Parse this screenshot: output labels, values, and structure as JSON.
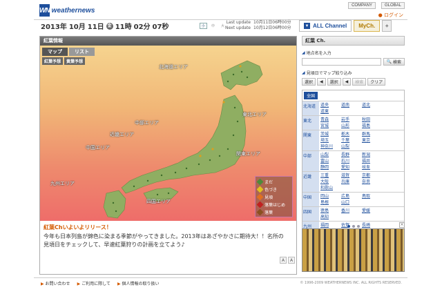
{
  "header": {
    "logo_mark": "WN",
    "logo_text": "weathernews",
    "nav": [
      "COMPANY",
      "GLOBAL"
    ],
    "login": "ログイン",
    "date": {
      "year": "2013年",
      "month": "10月",
      "day": "11日",
      "weekday": "金",
      "hour": "11時",
      "min": "02分",
      "sec": "07秒"
    },
    "text_sizes": [
      "小",
      "中",
      "大"
    ],
    "last_update_label": "Last update",
    "last_update": "10月11日06時00分",
    "next_update_label": "Next update",
    "next_update": "10月12日06時00分"
  },
  "tabs": {
    "all": "ALL Channel",
    "my": "MyCh.",
    "add": "+"
  },
  "panel": {
    "title": "紅葉情報",
    "map_tabs": [
      "マップ",
      "リスト"
    ],
    "view_tabs": [
      "紅葉予想",
      "黄葉予想"
    ],
    "areas": [
      "北海道エリア",
      "東北エリア",
      "中部エリア",
      "近畿エリア",
      "中国エリア",
      "関東エリア",
      "九州エリア",
      "四国エリア"
    ],
    "legend": [
      {
        "label": "まだ",
        "color": "#4f8a3a"
      },
      {
        "label": "色づき",
        "color": "#e0c020"
      },
      {
        "label": "見頃",
        "color": "#e07020"
      },
      {
        "label": "落葉はじめ",
        "color": "#c02020"
      },
      {
        "label": "落葉",
        "color": "#8a5020"
      }
    ],
    "news_title": "紅葉Chいよいよリリース！",
    "news_body": "今年も日本列島が錦色に染まる季節がやってきました。2013年はあざやかさに期待大！！名所の見頃日をチェックして、早速紅葉狩りの計画を立てよう♪",
    "scroll": [
      "A",
      "A"
    ]
  },
  "side": {
    "title": "紅葉 Ch.",
    "search_label": "地点名を入力",
    "search_btn": "検索",
    "filter_label": "見頃日でマップ絞り込み",
    "filter": [
      "選択",
      "◀",
      "選択",
      "◀",
      "検索",
      "クリア"
    ],
    "all": "全国",
    "regions": [
      {
        "name": "北海道",
        "prefs": [
          "道央",
          "道南",
          "道北",
          "道東"
        ]
      },
      {
        "name": "東北",
        "prefs": [
          "青森",
          "岩手",
          "秋田",
          "宮城",
          "山形",
          "福島"
        ]
      },
      {
        "name": "関東",
        "prefs": [
          "茨城",
          "栃木",
          "群馬",
          "埼玉",
          "千葉",
          "東京",
          "神奈川",
          "山梨"
        ]
      },
      {
        "name": "中部",
        "prefs": [
          "山梨",
          "長野",
          "新潟",
          "富山",
          "石川",
          "福井",
          "静岡",
          "愛知",
          "岐阜"
        ]
      },
      {
        "name": "近畿",
        "prefs": [
          "三重",
          "滋賀",
          "京都",
          "大阪",
          "兵庫",
          "奈良",
          "和歌山"
        ]
      },
      {
        "name": "中国",
        "prefs": [
          "岡山",
          "広島",
          "鳥取",
          "島根",
          "山口"
        ]
      },
      {
        "name": "四国",
        "prefs": [
          "徳島",
          "香川",
          "愛媛",
          "高知"
        ]
      },
      {
        "name": "九州",
        "prefs": [
          "福岡",
          "佐賀",
          "長崎",
          "大分",
          "熊本",
          "宮崎",
          "鹿児島"
        ]
      }
    ]
  },
  "footer": {
    "links": [
      "お問い合わせ",
      "ご利用に際して",
      "個人情報の取り扱い"
    ],
    "copyright": "1996-2009 WEATHERNEWS INC. ALL RIGHTS RESERVED."
  }
}
